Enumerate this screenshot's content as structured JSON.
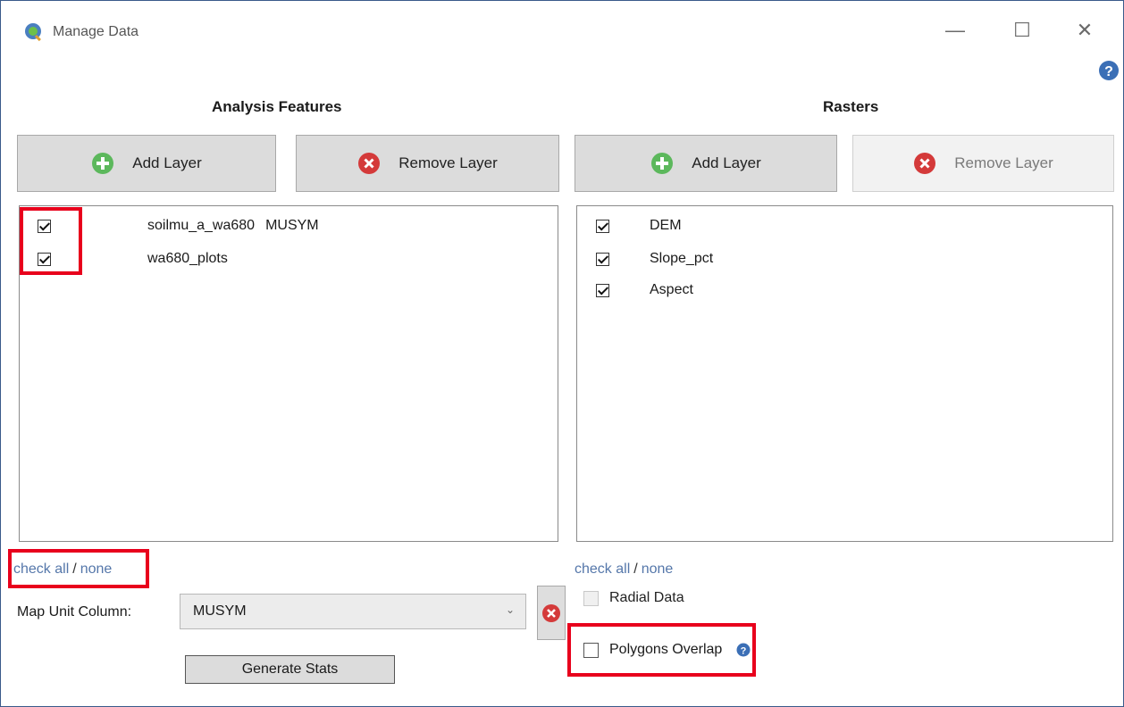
{
  "window": {
    "title": "Manage Data",
    "controls": {
      "minimize": "—",
      "maximize": "☐",
      "close": "✕"
    }
  },
  "analysis_features": {
    "heading": "Analysis Features",
    "add_label": "Add Layer",
    "remove_label": "Remove Layer",
    "items": [
      {
        "label": "soilmu_a_wa680",
        "field": "MUSYM",
        "checked": true
      },
      {
        "label": "wa680_plots",
        "field": "",
        "checked": true
      }
    ],
    "check_all": "check all",
    "separator": "/",
    "none": "none"
  },
  "rasters": {
    "heading": "Rasters",
    "add_label": "Add Layer",
    "remove_label": "Remove Layer",
    "items": [
      {
        "label": "DEM",
        "checked": true
      },
      {
        "label": "Slope_pct",
        "checked": true
      },
      {
        "label": "Aspect",
        "checked": true
      }
    ],
    "check_all": "check all",
    "separator": "/",
    "none": "none"
  },
  "map_unit": {
    "label": "Map Unit Column:",
    "selected": "MUSYM"
  },
  "generate_label": "Generate Stats",
  "options": {
    "radial": {
      "label": "Radial Data",
      "checked": false,
      "enabled": false
    },
    "overlap": {
      "label": "Polygons Overlap",
      "checked": false,
      "enabled": true
    }
  },
  "colors": {
    "highlight": "#e8001c",
    "link": "#5577aa",
    "add_green": "#5cb85c",
    "remove_red": "#d43a3a",
    "help_blue": "#3b6fb6"
  }
}
